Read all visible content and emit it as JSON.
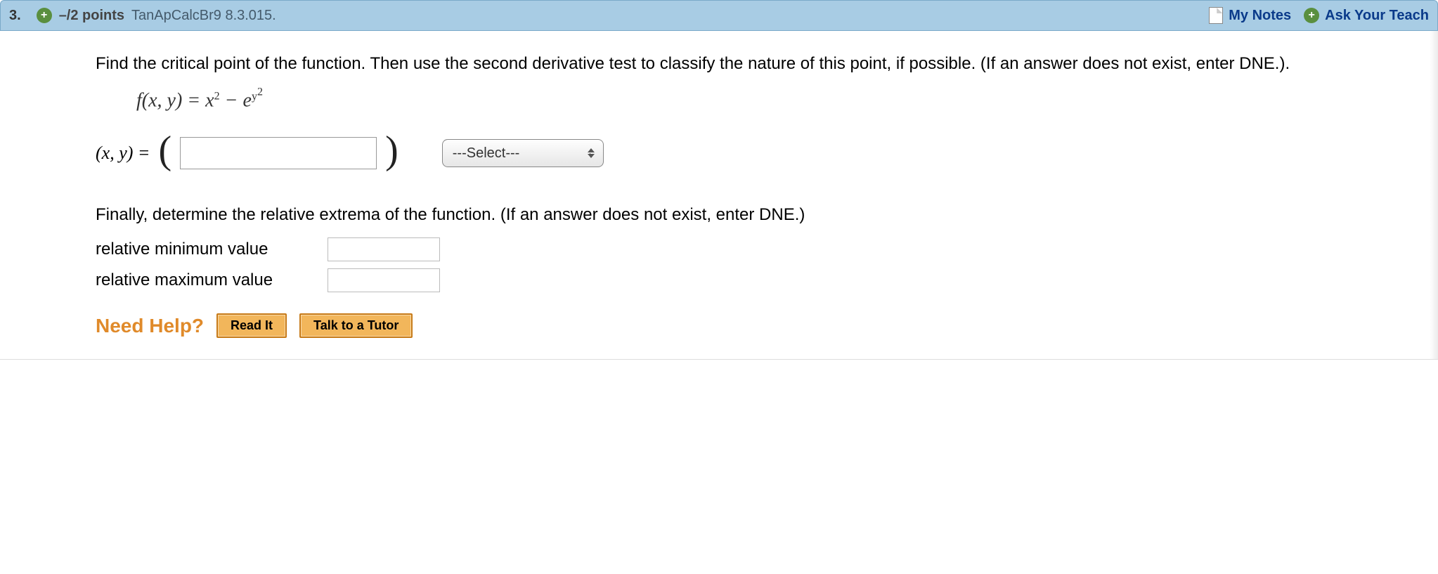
{
  "header": {
    "question_number": "3.",
    "expand_glyph": "+",
    "points": "–/2 points",
    "source": "TanApCalcBr9 8.3.015.",
    "my_notes": "My Notes",
    "ask_glyph": "+",
    "ask_teacher": "Ask Your Teach"
  },
  "body": {
    "prompt": "Find the critical point of the function. Then use the second derivative test to classify the nature of this point, if possible. (If an answer does not exist, enter DNE.).",
    "xy_label": "(x, y) = ",
    "select_placeholder": "---Select---",
    "sub_prompt": "Finally, determine the relative extrema of the function. (If an answer does not exist, enter DNE.)",
    "rel_min_label": "relative minimum value",
    "rel_max_label": "relative maximum value"
  },
  "help": {
    "label": "Need Help?",
    "read_it": "Read It",
    "tutor": "Talk to a Tutor"
  }
}
